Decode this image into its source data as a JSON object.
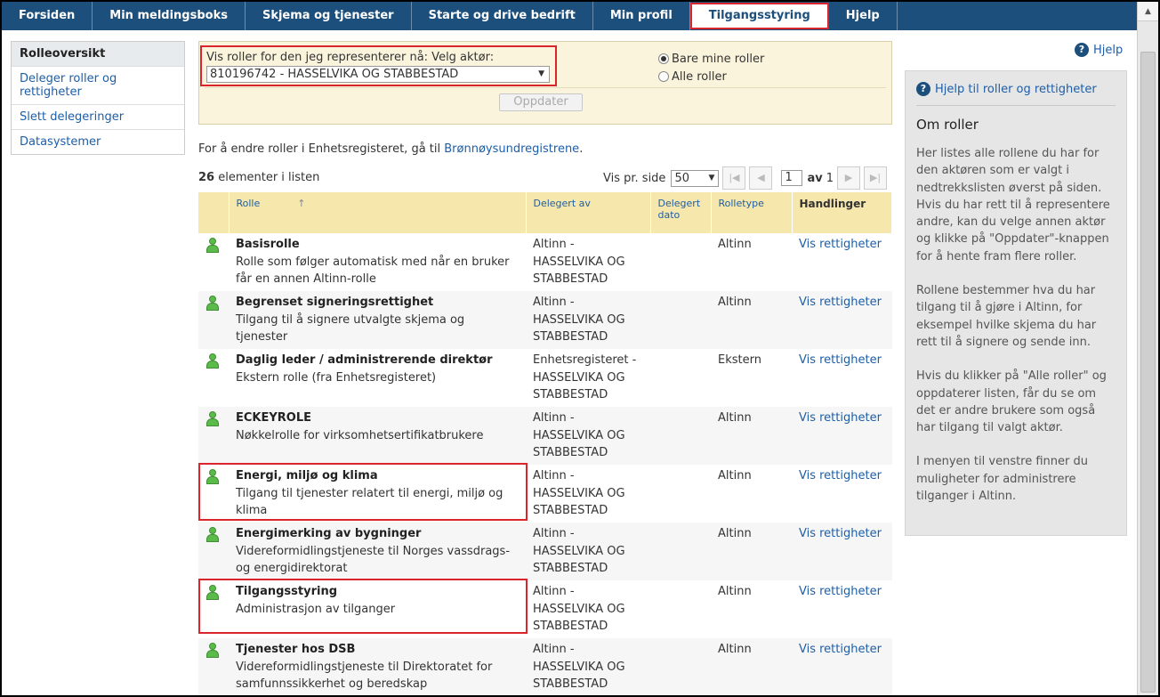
{
  "topnav": {
    "tabs": [
      {
        "label": "Forsiden"
      },
      {
        "label": "Min meldingsboks"
      },
      {
        "label": "Skjema og tjenester"
      },
      {
        "label": "Starte og drive bedrift"
      },
      {
        "label": "Min profil"
      },
      {
        "label": "Tilgangsstyring",
        "active": true
      },
      {
        "label": "Hjelp"
      }
    ]
  },
  "sidebar": {
    "items": [
      {
        "label": "Rolleoversikt"
      },
      {
        "label": "Deleger roller og rettigheter"
      },
      {
        "label": "Slett delegeringer"
      },
      {
        "label": "Datasystemer"
      }
    ]
  },
  "filter": {
    "actor_label": "Vis roller for den jeg representerer nå: Velg aktør:",
    "actor_value": "810196742 - HASSELVIKA OG STABBESTAD",
    "radio_mine": "Bare mine roller",
    "radio_all": "Alle roller",
    "update_button": "Oppdater"
  },
  "note": {
    "text": "For å endre roller i Enhetsregisteret, gå til ",
    "link": "Brønnøysundregistrene",
    "suffix": "."
  },
  "list": {
    "count": "26",
    "count_label": " elementer i listen",
    "per_page_label": "Vis pr. side",
    "per_page": "50",
    "page": "1",
    "of_label": "av",
    "total_pages": "1"
  },
  "table": {
    "headers": {
      "rolle": "Rolle",
      "delegert_av": "Delegert av",
      "delegert_dato_1": "Delegert",
      "delegert_dato_2": "dato",
      "rolletype": "Rolletype",
      "handlinger": "Handlinger"
    },
    "rows": [
      {
        "name": "Basisrolle",
        "desc1": "Rolle som følger automatisk med når en bruker",
        "desc2": "får en annen Altinn-rolle",
        "by1": "Altinn -",
        "by2": "HASSELVIKA OG",
        "by3": "STABBESTAD",
        "type": "Altinn",
        "action": "Vis rettigheter"
      },
      {
        "name": "Begrenset signeringsrettighet",
        "desc1": "Tilgang til å signere utvalgte skjema og",
        "desc2": "tjenester",
        "by1": "Altinn -",
        "by2": "HASSELVIKA OG",
        "by3": "STABBESTAD",
        "type": "Altinn",
        "action": "Vis rettigheter"
      },
      {
        "name": "Daglig leder / administrerende direktør",
        "desc1": "Ekstern rolle (fra Enhetsregisteret)",
        "desc2": "",
        "by1": "Enhetsregisteret -",
        "by2": "HASSELVIKA OG",
        "by3": "STABBESTAD",
        "type": "Ekstern",
        "action": "Vis rettigheter"
      },
      {
        "name": "ECKEYROLE",
        "desc1": "Nøkkelrolle for virksomhetsertifikatbrukere",
        "desc2": "",
        "by1": "Altinn -",
        "by2": "HASSELVIKA OG",
        "by3": "STABBESTAD",
        "type": "Altinn",
        "action": "Vis rettigheter"
      },
      {
        "name": "Energi, miljø og klima",
        "desc1": "Tilgang til tjenester relatert til energi, miljø og",
        "desc2": "klima",
        "by1": "Altinn -",
        "by2": "HASSELVIKA OG",
        "by3": "STABBESTAD",
        "type": "Altinn",
        "action": "Vis rettigheter"
      },
      {
        "name": "Energimerking av bygninger",
        "desc1": "Videreformidlingstjeneste til Norges vassdrags-",
        "desc2": "og energidirektorat",
        "by1": "Altinn -",
        "by2": "HASSELVIKA OG",
        "by3": "STABBESTAD",
        "type": "Altinn",
        "action": "Vis rettigheter"
      },
      {
        "name": "Tilgangsstyring",
        "desc1": "Administrasjon av tilganger",
        "desc2": "",
        "by1": "Altinn -",
        "by2": "HASSELVIKA OG",
        "by3": "STABBESTAD",
        "type": "Altinn",
        "action": "Vis rettigheter"
      },
      {
        "name": "Tjenester hos DSB",
        "desc1": "Videreformidlingstjeneste til Direktoratet for",
        "desc2": "samfunnssikkerhet og beredskap",
        "by1": "Altinn -",
        "by2": "HASSELVIKA OG",
        "by3": "STABBESTAD",
        "type": "Altinn",
        "action": "Vis rettigheter"
      }
    ]
  },
  "help": {
    "top_link": "Hjelp",
    "panel_link": "Hjelp til roller og rettigheter",
    "title": "Om roller",
    "p1": "Her listes alle rollene du har for den aktøren som er valgt i nedtrekkslisten øverst på siden. Hvis du har rett til å representere andre, kan du velge annen aktør og klikke på \"Oppdater\"-knappen for å hente fram flere roller.",
    "p2": "Rollene bestemmer hva du har tilgang til å gjøre i Altinn, for eksempel hvilke skjema du har rett til å signere og sende inn.",
    "p3": "Hvis du klikker på \"Alle roller\" og oppdaterer listen, får du se om det er andre brukere som også har tilgang til valgt aktør.",
    "p4": "I menyen til venstre finner du muligheter for administrere tilganger i Altinn."
  },
  "colors": {
    "nav_bg": "#1d4f7c",
    "link": "#1d5ea8",
    "highlight": "#d9252b",
    "filter_bg": "#fbf4dd",
    "header_bg": "#f6e7ad"
  }
}
